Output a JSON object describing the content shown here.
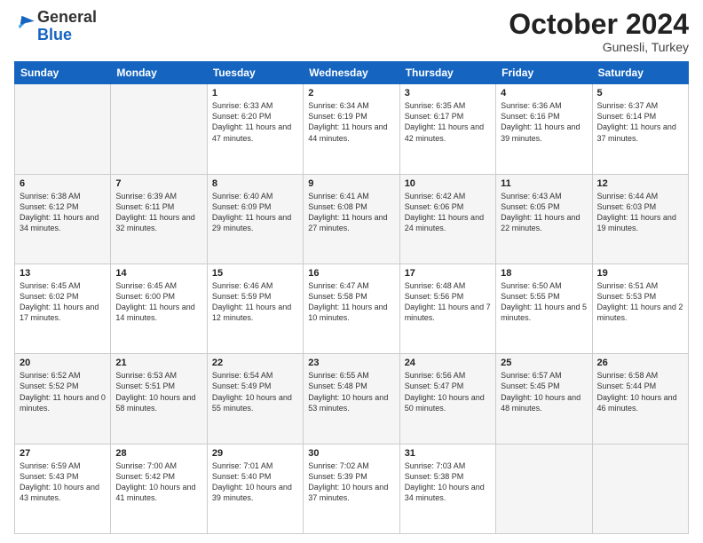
{
  "header": {
    "logo_general": "General",
    "logo_blue": "Blue",
    "month_title": "October 2024",
    "location": "Gunesli, Turkey"
  },
  "weekdays": [
    "Sunday",
    "Monday",
    "Tuesday",
    "Wednesday",
    "Thursday",
    "Friday",
    "Saturday"
  ],
  "weeks": [
    [
      {
        "day": "",
        "sunrise": "",
        "sunset": "",
        "daylight": "",
        "empty": true
      },
      {
        "day": "",
        "sunrise": "",
        "sunset": "",
        "daylight": "",
        "empty": true
      },
      {
        "day": "1",
        "sunrise": "Sunrise: 6:33 AM",
        "sunset": "Sunset: 6:20 PM",
        "daylight": "Daylight: 11 hours and 47 minutes."
      },
      {
        "day": "2",
        "sunrise": "Sunrise: 6:34 AM",
        "sunset": "Sunset: 6:19 PM",
        "daylight": "Daylight: 11 hours and 44 minutes."
      },
      {
        "day": "3",
        "sunrise": "Sunrise: 6:35 AM",
        "sunset": "Sunset: 6:17 PM",
        "daylight": "Daylight: 11 hours and 42 minutes."
      },
      {
        "day": "4",
        "sunrise": "Sunrise: 6:36 AM",
        "sunset": "Sunset: 6:16 PM",
        "daylight": "Daylight: 11 hours and 39 minutes."
      },
      {
        "day": "5",
        "sunrise": "Sunrise: 6:37 AM",
        "sunset": "Sunset: 6:14 PM",
        "daylight": "Daylight: 11 hours and 37 minutes."
      }
    ],
    [
      {
        "day": "6",
        "sunrise": "Sunrise: 6:38 AM",
        "sunset": "Sunset: 6:12 PM",
        "daylight": "Daylight: 11 hours and 34 minutes."
      },
      {
        "day": "7",
        "sunrise": "Sunrise: 6:39 AM",
        "sunset": "Sunset: 6:11 PM",
        "daylight": "Daylight: 11 hours and 32 minutes."
      },
      {
        "day": "8",
        "sunrise": "Sunrise: 6:40 AM",
        "sunset": "Sunset: 6:09 PM",
        "daylight": "Daylight: 11 hours and 29 minutes."
      },
      {
        "day": "9",
        "sunrise": "Sunrise: 6:41 AM",
        "sunset": "Sunset: 6:08 PM",
        "daylight": "Daylight: 11 hours and 27 minutes."
      },
      {
        "day": "10",
        "sunrise": "Sunrise: 6:42 AM",
        "sunset": "Sunset: 6:06 PM",
        "daylight": "Daylight: 11 hours and 24 minutes."
      },
      {
        "day": "11",
        "sunrise": "Sunrise: 6:43 AM",
        "sunset": "Sunset: 6:05 PM",
        "daylight": "Daylight: 11 hours and 22 minutes."
      },
      {
        "day": "12",
        "sunrise": "Sunrise: 6:44 AM",
        "sunset": "Sunset: 6:03 PM",
        "daylight": "Daylight: 11 hours and 19 minutes."
      }
    ],
    [
      {
        "day": "13",
        "sunrise": "Sunrise: 6:45 AM",
        "sunset": "Sunset: 6:02 PM",
        "daylight": "Daylight: 11 hours and 17 minutes."
      },
      {
        "day": "14",
        "sunrise": "Sunrise: 6:45 AM",
        "sunset": "Sunset: 6:00 PM",
        "daylight": "Daylight: 11 hours and 14 minutes."
      },
      {
        "day": "15",
        "sunrise": "Sunrise: 6:46 AM",
        "sunset": "Sunset: 5:59 PM",
        "daylight": "Daylight: 11 hours and 12 minutes."
      },
      {
        "day": "16",
        "sunrise": "Sunrise: 6:47 AM",
        "sunset": "Sunset: 5:58 PM",
        "daylight": "Daylight: 11 hours and 10 minutes."
      },
      {
        "day": "17",
        "sunrise": "Sunrise: 6:48 AM",
        "sunset": "Sunset: 5:56 PM",
        "daylight": "Daylight: 11 hours and 7 minutes."
      },
      {
        "day": "18",
        "sunrise": "Sunrise: 6:50 AM",
        "sunset": "Sunset: 5:55 PM",
        "daylight": "Daylight: 11 hours and 5 minutes."
      },
      {
        "day": "19",
        "sunrise": "Sunrise: 6:51 AM",
        "sunset": "Sunset: 5:53 PM",
        "daylight": "Daylight: 11 hours and 2 minutes."
      }
    ],
    [
      {
        "day": "20",
        "sunrise": "Sunrise: 6:52 AM",
        "sunset": "Sunset: 5:52 PM",
        "daylight": "Daylight: 11 hours and 0 minutes."
      },
      {
        "day": "21",
        "sunrise": "Sunrise: 6:53 AM",
        "sunset": "Sunset: 5:51 PM",
        "daylight": "Daylight: 10 hours and 58 minutes."
      },
      {
        "day": "22",
        "sunrise": "Sunrise: 6:54 AM",
        "sunset": "Sunset: 5:49 PM",
        "daylight": "Daylight: 10 hours and 55 minutes."
      },
      {
        "day": "23",
        "sunrise": "Sunrise: 6:55 AM",
        "sunset": "Sunset: 5:48 PM",
        "daylight": "Daylight: 10 hours and 53 minutes."
      },
      {
        "day": "24",
        "sunrise": "Sunrise: 6:56 AM",
        "sunset": "Sunset: 5:47 PM",
        "daylight": "Daylight: 10 hours and 50 minutes."
      },
      {
        "day": "25",
        "sunrise": "Sunrise: 6:57 AM",
        "sunset": "Sunset: 5:45 PM",
        "daylight": "Daylight: 10 hours and 48 minutes."
      },
      {
        "day": "26",
        "sunrise": "Sunrise: 6:58 AM",
        "sunset": "Sunset: 5:44 PM",
        "daylight": "Daylight: 10 hours and 46 minutes."
      }
    ],
    [
      {
        "day": "27",
        "sunrise": "Sunrise: 6:59 AM",
        "sunset": "Sunset: 5:43 PM",
        "daylight": "Daylight: 10 hours and 43 minutes."
      },
      {
        "day": "28",
        "sunrise": "Sunrise: 7:00 AM",
        "sunset": "Sunset: 5:42 PM",
        "daylight": "Daylight: 10 hours and 41 minutes."
      },
      {
        "day": "29",
        "sunrise": "Sunrise: 7:01 AM",
        "sunset": "Sunset: 5:40 PM",
        "daylight": "Daylight: 10 hours and 39 minutes."
      },
      {
        "day": "30",
        "sunrise": "Sunrise: 7:02 AM",
        "sunset": "Sunset: 5:39 PM",
        "daylight": "Daylight: 10 hours and 37 minutes."
      },
      {
        "day": "31",
        "sunrise": "Sunrise: 7:03 AM",
        "sunset": "Sunset: 5:38 PM",
        "daylight": "Daylight: 10 hours and 34 minutes."
      },
      {
        "day": "",
        "sunrise": "",
        "sunset": "",
        "daylight": "",
        "empty": true
      },
      {
        "day": "",
        "sunrise": "",
        "sunset": "",
        "daylight": "",
        "empty": true
      }
    ]
  ]
}
